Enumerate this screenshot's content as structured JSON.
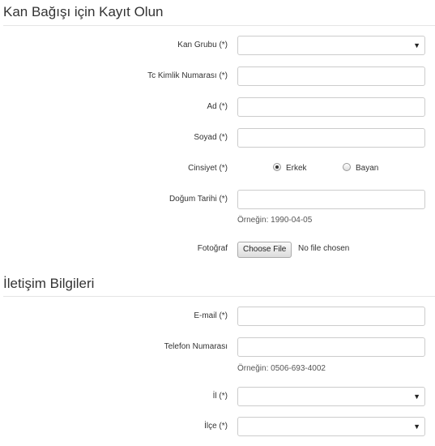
{
  "section1": {
    "title": "Kan Bağışı için Kayıt Olun"
  },
  "fields": {
    "blood_group": {
      "label": "Kan Grubu (*)",
      "value": ""
    },
    "tc_number": {
      "label": "Tc Kimlik Numarası (*)",
      "value": ""
    },
    "first_name": {
      "label": "Ad (*)",
      "value": ""
    },
    "last_name": {
      "label": "Soyad (*)",
      "value": ""
    },
    "gender": {
      "label": "Cinsiyet (*)",
      "options": [
        "Erkek",
        "Bayan"
      ],
      "selected": "Erkek"
    },
    "birth_date": {
      "label": "Doğum Tarihi (*)",
      "value": "",
      "hint": "Örneğin: 1990-04-05"
    },
    "photo": {
      "label": "Fotoğraf",
      "button": "Choose File",
      "status": "No file chosen"
    }
  },
  "section2": {
    "title": "İletişim Bilgileri"
  },
  "contact": {
    "email": {
      "label": "E-mail (*)",
      "value": ""
    },
    "phone": {
      "label": "Telefon Numarası",
      "value": "",
      "hint": "Örneğin: 0506-693-4002"
    },
    "city": {
      "label": "İl (*)",
      "value": ""
    },
    "district": {
      "label": "İlçe (*)",
      "value": ""
    }
  },
  "icons": {
    "select_arrow": "▼"
  }
}
